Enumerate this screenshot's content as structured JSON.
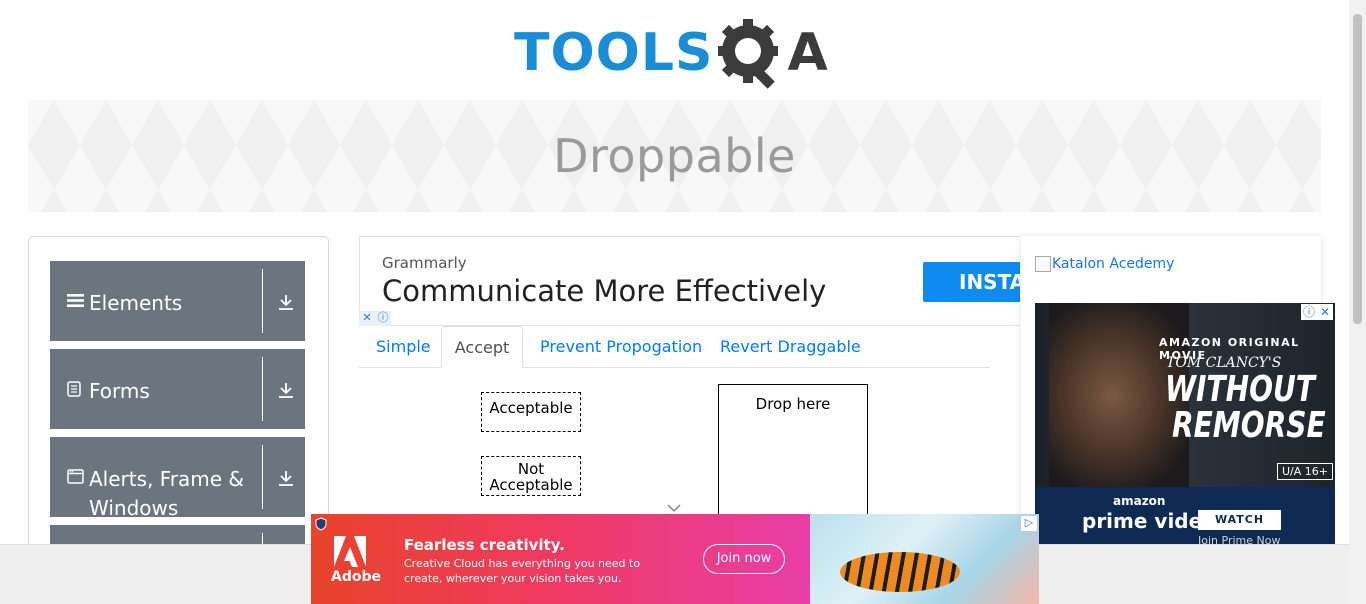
{
  "header": {
    "logo_text_left": "TOOLS",
    "logo_text_right": "A",
    "brand_color": "#1b8dd6",
    "dark_color": "#3b3b3b"
  },
  "banner": {
    "title": "Droppable"
  },
  "sidebar": {
    "groups": [
      {
        "label": "Elements",
        "icon": "hamburger-icon"
      },
      {
        "label": "Forms",
        "icon": "form-icon"
      },
      {
        "label": "Alerts, Frame & Windows",
        "icon": "window-icon"
      }
    ],
    "group_color": "#6b7580"
  },
  "ad_grammarly": {
    "brand": "Grammarly",
    "headline": "Communicate More Effectively",
    "button": "INSTAL"
  },
  "tabs": [
    {
      "label": "Simple",
      "active": false
    },
    {
      "label": "Accept",
      "active": true
    },
    {
      "label": "Prevent Propogation",
      "active": false
    },
    {
      "label": "Revert Draggable",
      "active": false
    }
  ],
  "droppable": {
    "acceptable": "Acceptable",
    "not_acceptable": "Not Acceptable",
    "drop_target": "Drop here"
  },
  "right_ads": {
    "katalon_alt": "Katalon Acedemy",
    "prime": {
      "tagline": "AMAZON ORIGINAL MOVIE",
      "author": "TOM CLANCY'S",
      "title_line1": "WITHOUT",
      "title_line2": "REMORSE",
      "rating": "U/A 16+",
      "amazon": "amazon",
      "brand": "prime video",
      "cta": "WATCH NOW",
      "join": "Join Prime Now"
    }
  },
  "ad_adobe": {
    "brand": "Adobe",
    "headline": "Fearless creativity.",
    "subtext": "Creative Cloud has everything you need to create, wherever your vision takes you.",
    "button": "Join now"
  }
}
